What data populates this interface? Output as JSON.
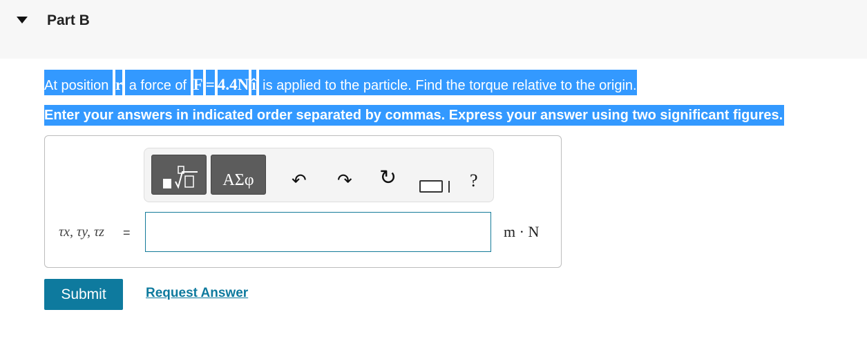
{
  "header": {
    "part_title": "Part B"
  },
  "question": {
    "text_prefix": "At position ",
    "position_symbol": "r",
    "text_mid": " a force of ",
    "force_symbol": "F",
    "equals": "=",
    "force_value": "4.4",
    "force_unit": "N",
    "unit_vector": "î",
    "text_suffix": " is applied to the particle. Find the torque relative to the origin.",
    "instructions": "Enter your answers in indicated order separated by commas. Express your answer using two significant figures."
  },
  "toolbar": {
    "templates_icon": "templates-icon",
    "greek_label": "ΑΣφ",
    "undo_icon": "↶",
    "redo_icon": "↷",
    "reset_icon": "↻",
    "keyboard_icon": "keyboard-icon",
    "help_label": "?"
  },
  "answer": {
    "variables_label": "τx, τy, τz",
    "equals_label": "=",
    "input_value": "",
    "units_label": "m · N"
  },
  "actions": {
    "submit_label": "Submit",
    "request_answer_label": "Request Answer"
  },
  "colors": {
    "selection": "#3399ff",
    "accent": "#0e7a9e",
    "header_bg": "#f7f7f7"
  }
}
